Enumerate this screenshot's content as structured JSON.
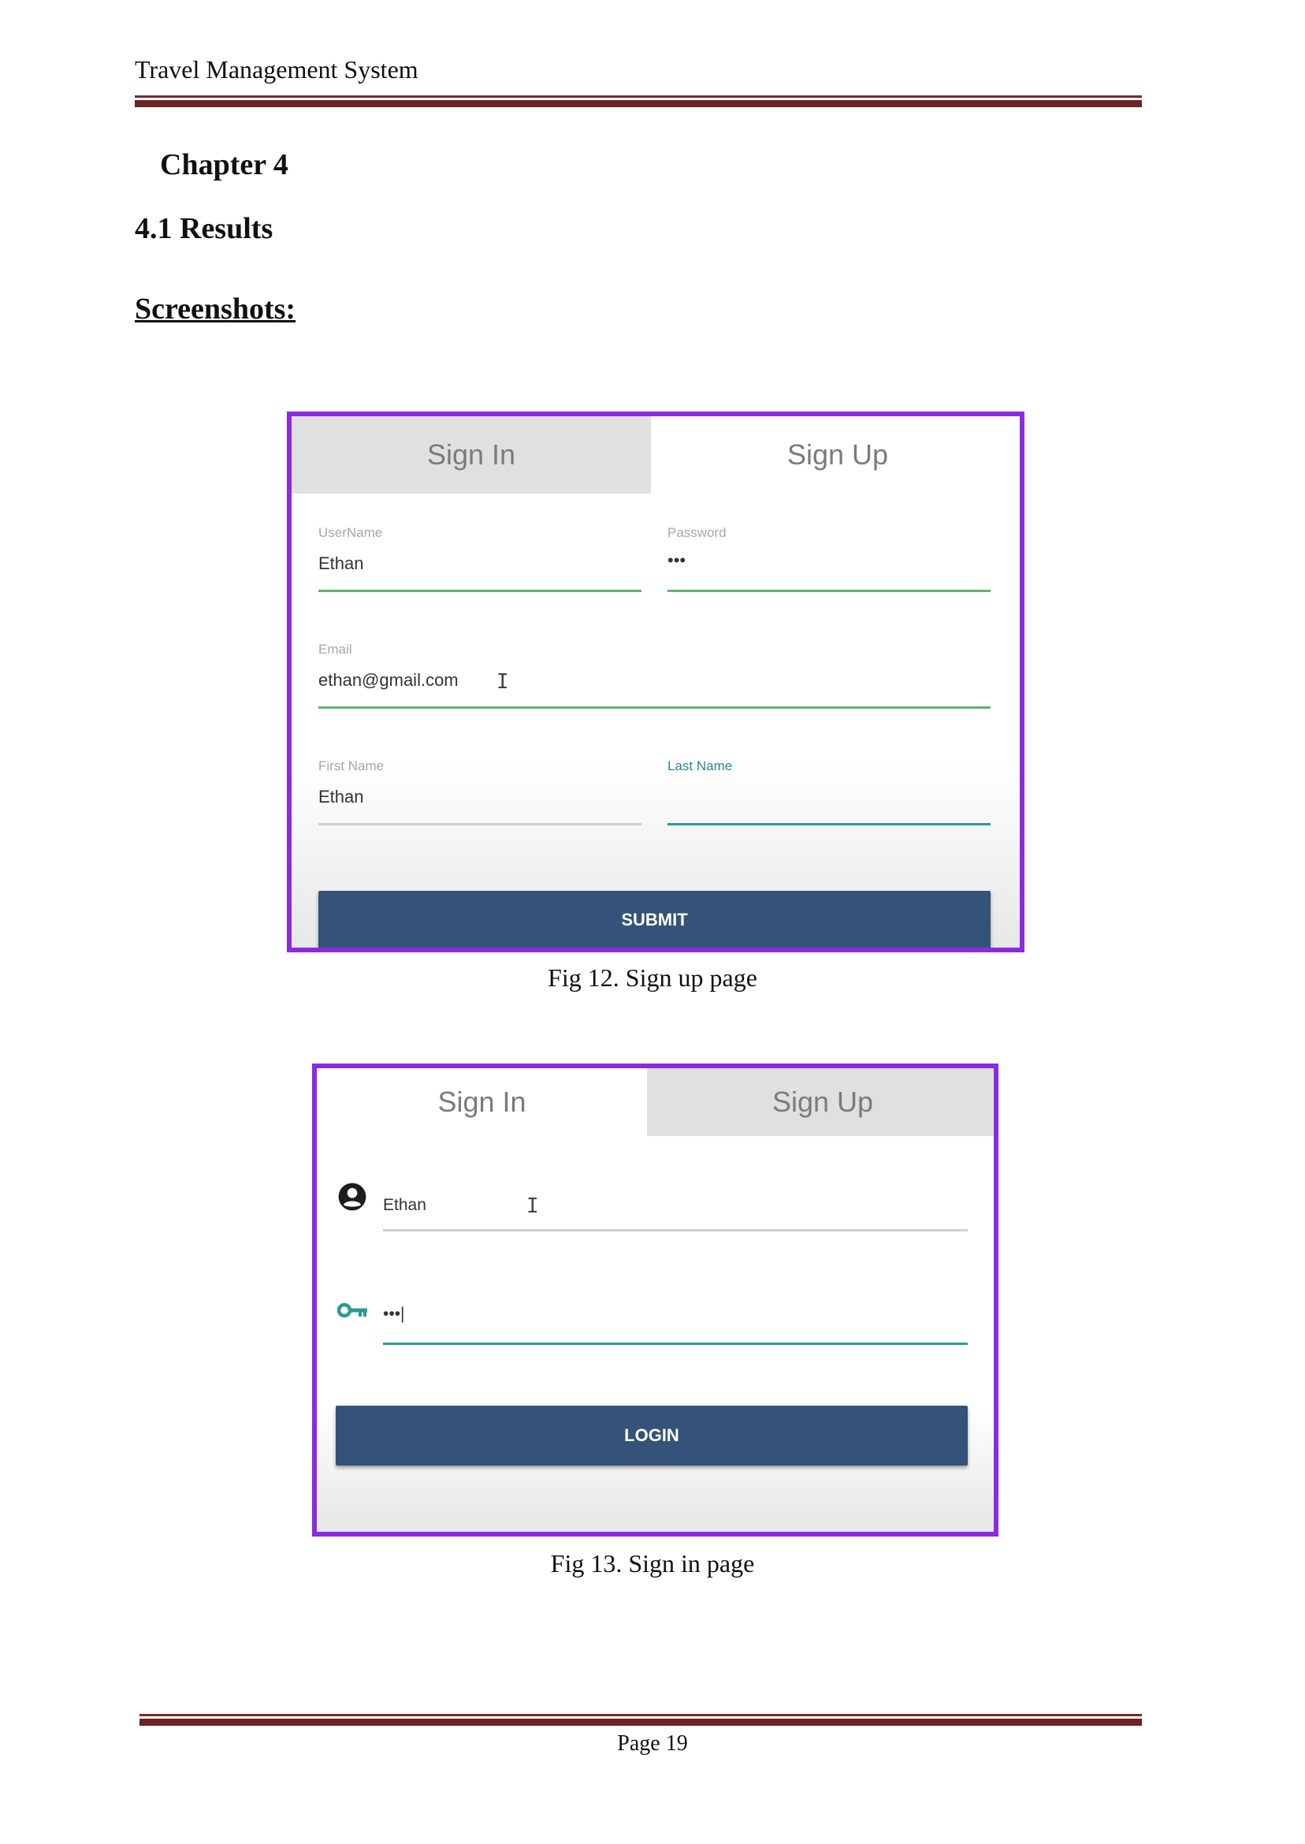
{
  "header": {
    "running_title": "Travel Management System"
  },
  "chapter_title": "Chapter 4",
  "section_title": "4.1 Results",
  "subsection_title": "Screenshots:",
  "figure_signup": {
    "tabs": [
      "Sign In",
      "Sign Up"
    ],
    "active_tab": "Sign Up",
    "fields": {
      "username_label": "UserName",
      "username_value": "Ethan",
      "password_label": "Password",
      "password_value": "•••",
      "email_label": "Email",
      "email_value": "ethan@gmail.com",
      "firstname_label": "First Name",
      "firstname_value": "Ethan",
      "lastname_label": "Last Name",
      "lastname_value": ""
    },
    "submit_label": "SUBMIT",
    "caption": "Fig 12. Sign up page"
  },
  "figure_signin": {
    "tabs": [
      "Sign In",
      "Sign Up"
    ],
    "active_tab": "Sign In",
    "username_value": "Ethan",
    "password_value": "•••|",
    "login_label": "LOGIN",
    "caption": "Fig 13. Sign in page",
    "icons": {
      "user": "account-circle-icon",
      "password": "key-icon"
    }
  },
  "colors": {
    "frame": "#8a2be2",
    "button": "#34527a",
    "rule": "#6e2424",
    "focus_teal": "#2a9a96",
    "valid_green": "#63b26a"
  },
  "footer": {
    "page_label": "Page 19"
  }
}
